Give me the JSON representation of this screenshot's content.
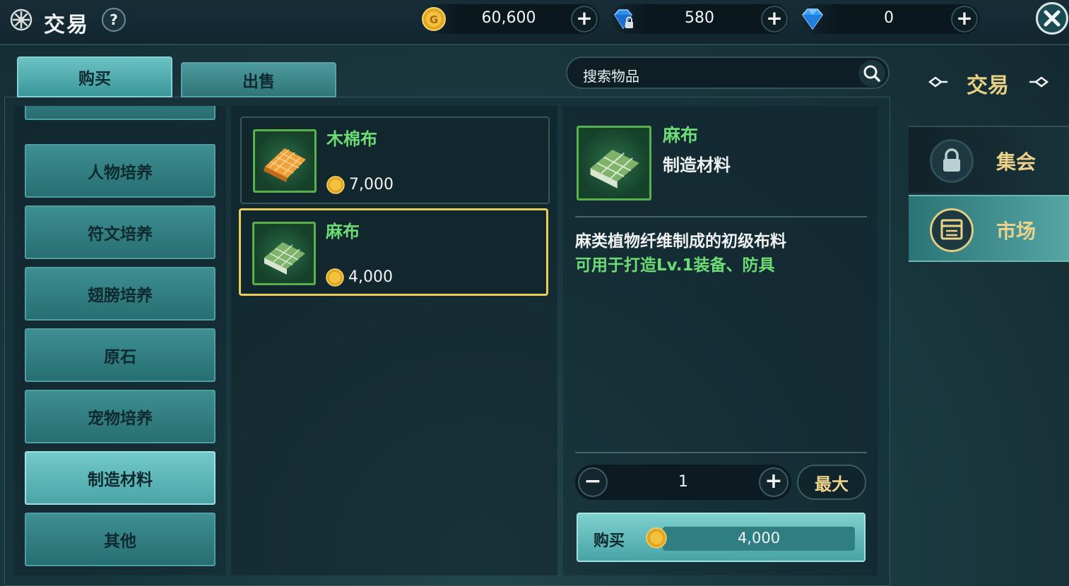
{
  "header": {
    "title": "交易",
    "help_label": "?",
    "gold": "60,600",
    "bound_diamond": "580",
    "diamond": "0",
    "plus_label": "+"
  },
  "tabs": {
    "buy": "购买",
    "sell": "出售"
  },
  "search": {
    "placeholder": "搜索物品"
  },
  "side_panel": {
    "title": "交易",
    "gather": "集会",
    "market": "市场"
  },
  "categories": [
    {
      "label": "人物培养"
    },
    {
      "label": "符文培养"
    },
    {
      "label": "翅膀培养"
    },
    {
      "label": "原石"
    },
    {
      "label": "宠物培养"
    },
    {
      "label": "制造材料",
      "active": true
    },
    {
      "label": "其他"
    }
  ],
  "items": [
    {
      "name": "木棉布",
      "price": "7,000",
      "icon": "kapok-cloth-icon"
    },
    {
      "name": "麻布",
      "price": "4,000",
      "icon": "linen-cloth-icon",
      "selected": true
    }
  ],
  "detail": {
    "name": "麻布",
    "type": "制造材料",
    "desc_line1": "麻类植物纤维制成的初级布料",
    "desc_line2": "可用于打造Lv.1装备、防具",
    "quantity": "1",
    "minus_label": "−",
    "plus_label": "+",
    "max_label": "最大",
    "buy_label": "购买",
    "total_price": "4,000"
  },
  "colors": {
    "accent_teal": "#4aa4a6",
    "item_name_green": "#6ddc74",
    "gold_text": "#ecd28a",
    "selected_border": "#e8cd5a"
  }
}
